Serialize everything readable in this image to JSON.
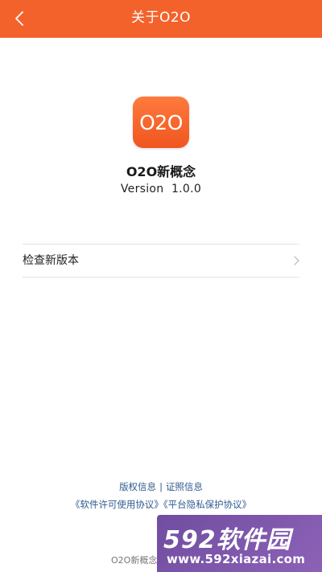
{
  "header": {
    "title": "关于O2O",
    "background_color": "#f4622c"
  },
  "app": {
    "icon_text": "O2O",
    "name": "O2O新概念",
    "version": "Version  1.0.0"
  },
  "menu": {
    "check_update_label": "检查新版本"
  },
  "footer": {
    "copyright_info": "版权信息",
    "separator": "|",
    "license_info": "证照信息",
    "software_agreement": "《软件许可使用协议》",
    "privacy_agreement": "《平台隐私保护协议》",
    "copyright_text": "O2O新概念"
  },
  "watermark": {
    "brand": "592软件园",
    "url": "www.592xiazai.com"
  }
}
